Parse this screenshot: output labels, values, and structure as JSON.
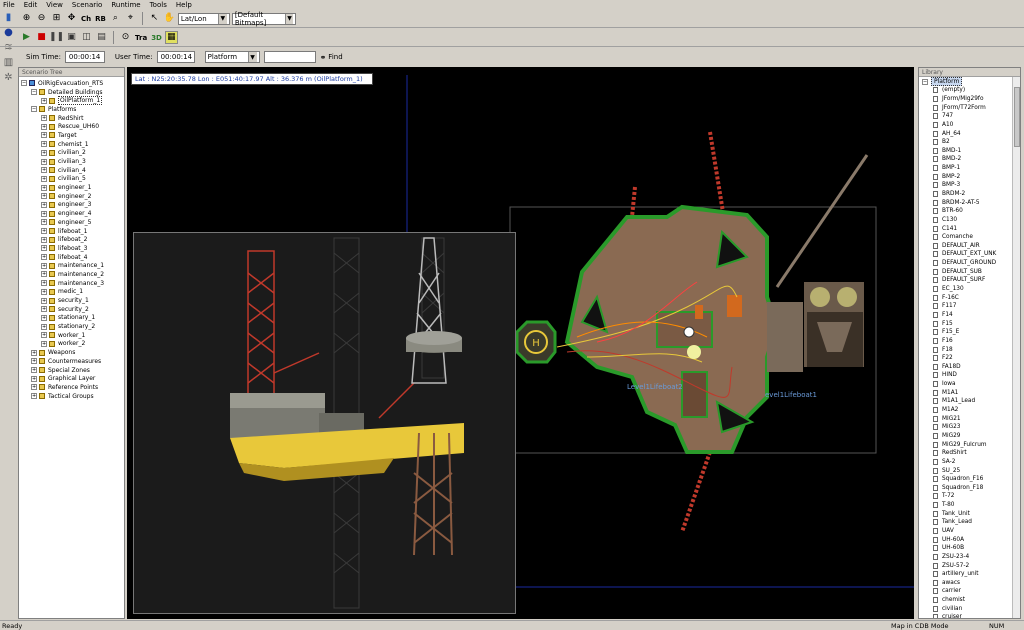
{
  "menu": [
    "File",
    "Edit",
    "View",
    "Scenario",
    "Runtime",
    "Tools",
    "Help"
  ],
  "toolbar": {
    "coord_system": "Lat/Lon",
    "bitmaps": "[Default Bitmaps]",
    "ch_label": "Ch",
    "rb_label": "RB",
    "tra_label": "Tra",
    "three_d_label": "3D"
  },
  "time_bar": {
    "sim_time_label": "Sim Time:",
    "sim_time": "00:00:14",
    "user_time_label": "User Time:",
    "user_time": "00:00:14",
    "filter_value": "Platform",
    "search_value": "",
    "find_label": "Find"
  },
  "scenario_tree": {
    "title": "Scenario Tree",
    "root": "OilRigEvacuation_RTS",
    "detailed_buildings": "Detailed Buildings",
    "oil_platform": "OilPlatform_1",
    "platforms": "Platforms",
    "platform_items": [
      "RedShirt",
      "Rescue_UH60",
      "Target",
      "chemist_1",
      "civilian_2",
      "civilian_3",
      "civilian_4",
      "civilian_5",
      "engineer_1",
      "engineer_2",
      "engineer_3",
      "engineer_4",
      "engineer_5",
      "lifeboat_1",
      "lifeboat_2",
      "lifeboat_3",
      "lifeboat_4",
      "maintenance_1",
      "maintenance_2",
      "maintenance_3",
      "medic_1",
      "security_1",
      "security_2",
      "stationary_1",
      "stationary_2",
      "worker_1",
      "worker_2"
    ],
    "other_groups": [
      "Weapons",
      "Countermeasures",
      "Special Zones",
      "Graphical Layer",
      "Reference Points",
      "Tactical Groups"
    ]
  },
  "viewport": {
    "coord_readout": "Lat : N25:20:35.78  Lon : E051:40:17.97  Alt : 36.376 m  (OilPlatform_1)",
    "map_label_1": "Level1Lifeboat2",
    "map_label_2": "evel1Lifeboat1"
  },
  "library": {
    "title": "Library",
    "root": "Platform",
    "items": [
      "(empty)",
      "JForm/Mig29fo",
      "JForm/T72Form",
      "747",
      "A10",
      "AH_64",
      "B2",
      "BMD-1",
      "BMD-2",
      "BMP-1",
      "BMP-2",
      "BMP-3",
      "BRDM-2",
      "BRDM-2-AT-5",
      "BTR-60",
      "C130",
      "C141",
      "Comanche",
      "DEFAULT_AIR",
      "DEFAULT_EXT_UNK",
      "DEFAULT_GROUND",
      "DEFAULT_SUB",
      "DEFAULT_SURF",
      "EC_130",
      "F-16C",
      "F117",
      "F14",
      "F15",
      "F15_E",
      "F16",
      "F18",
      "F22",
      "FA18D",
      "HIND",
      "Iowa",
      "M1A1",
      "M1A1_Lead",
      "M1A2",
      "MIG21",
      "MiG23",
      "MiG29",
      "MiG29_Fulcrum",
      "RedShirt",
      "SA-2",
      "SU_25",
      "Squadron_F16",
      "Squadron_F18",
      "T-72",
      "T-80",
      "Tank_Unit",
      "Tank_Lead",
      "UAV",
      "UH-60A",
      "UH-60B",
      "ZSU-23-4",
      "ZSU-57-2",
      "artillery_unit",
      "awacs",
      "carrier",
      "chemist",
      "civilian",
      "cruiser"
    ]
  },
  "status": {
    "left": "Ready",
    "mode": "Map in CDB Mode",
    "num": "NUM"
  },
  "colors": {
    "background_ui": "#d4d0c8",
    "viewport": "#000000",
    "walkway_green": "#2a9a2a",
    "deck_brown": "#8a6a52",
    "leg_red": "#c0392b",
    "hull_yellow": "#e8c83a"
  }
}
